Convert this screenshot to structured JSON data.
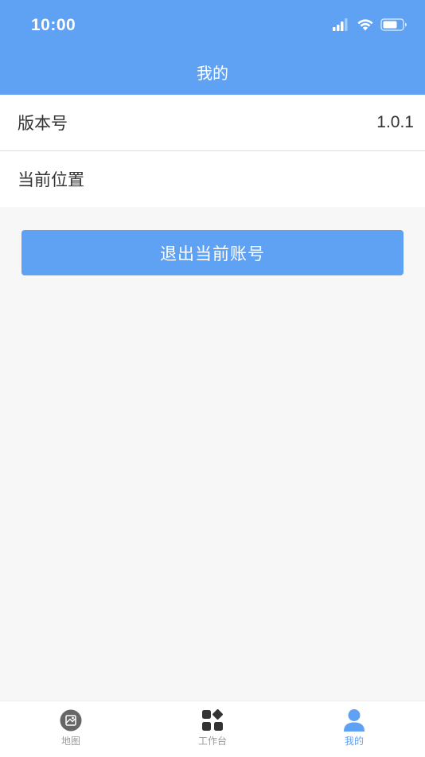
{
  "status_bar": {
    "time": "10:00"
  },
  "nav": {
    "title": "我的"
  },
  "list": {
    "items": [
      {
        "label": "版本号",
        "value": "1.0.1"
      },
      {
        "label": "当前位置",
        "value": ""
      }
    ]
  },
  "logout": {
    "label": "退出当前账号"
  },
  "tabs": [
    {
      "label": "地图",
      "icon": "map-icon",
      "active": false
    },
    {
      "label": "工作台",
      "icon": "workbench-icon",
      "active": false
    },
    {
      "label": "我的",
      "icon": "user-icon",
      "active": true
    }
  ],
  "colors": {
    "primary": "#5fa1f2",
    "background": "#f7f7f7",
    "tab_inactive": "#999999"
  }
}
